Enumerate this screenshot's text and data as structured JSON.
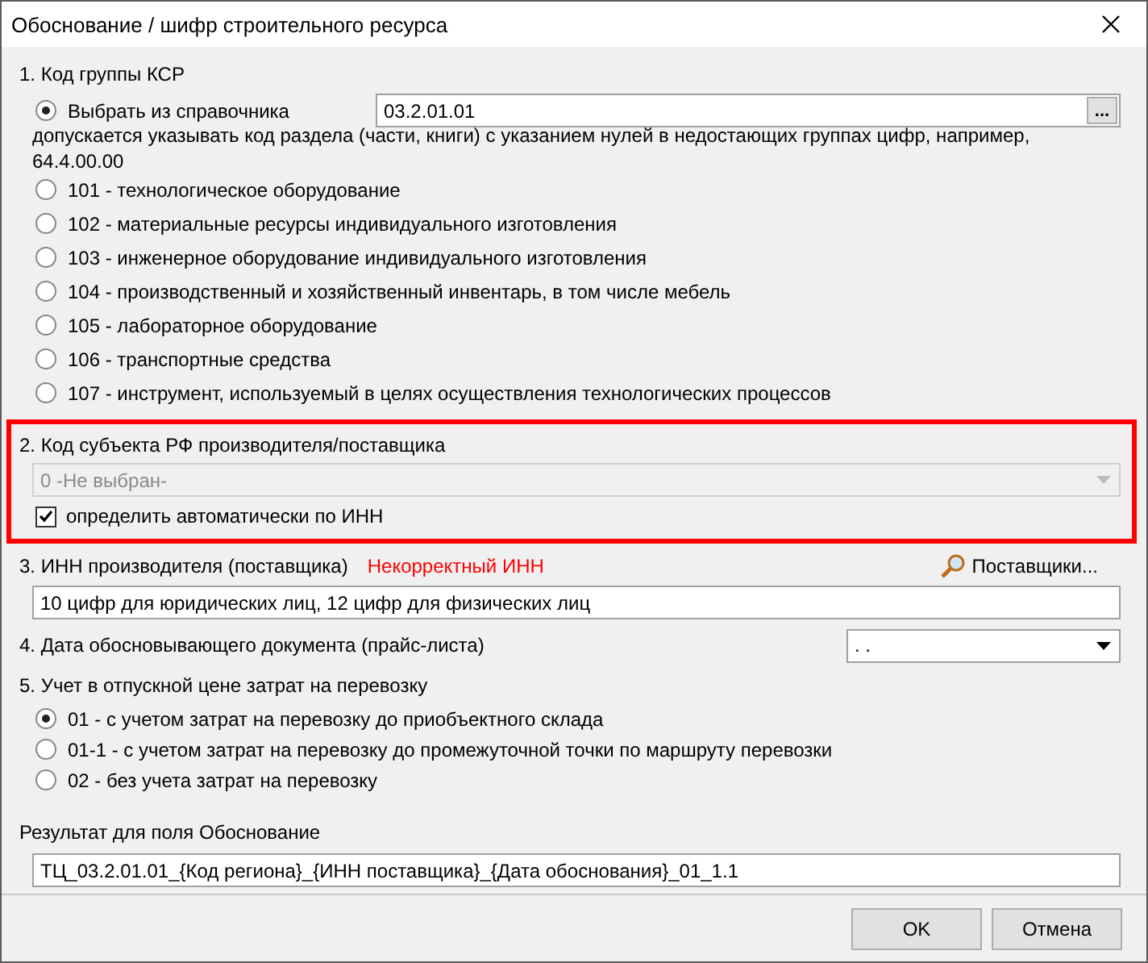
{
  "window": {
    "title": "Обоснование / шифр строительного ресурса"
  },
  "section1": {
    "heading": "1. Код группы КСР",
    "choose": {
      "label": "Выбрать из справочника",
      "selected": true,
      "value": "03.2.01.01",
      "button": "..."
    },
    "hint": "допускается указывать код раздела (части, книги) с указанием нулей в недостающих группах цифр,  например, 64.4.00.00",
    "options": [
      {
        "label": "101 - технологическое оборудование",
        "selected": false
      },
      {
        "label": "102 - материальные ресурсы индивидуального изготовления",
        "selected": false
      },
      {
        "label": "103 - инженерное оборудование индивидуального изготовления",
        "selected": false
      },
      {
        "label": "104 - производственный и хозяйственный инвентарь, в том числе мебель",
        "selected": false
      },
      {
        "label": "105 - лабораторное оборудование",
        "selected": false
      },
      {
        "label": "106 - транспортные средства",
        "selected": false
      },
      {
        "label": "107 - инструмент, используемый в целях осуществления технологических процессов",
        "selected": false
      }
    ]
  },
  "section2": {
    "heading": "2. Код субъекта РФ производителя/поставщика",
    "highlighted": true,
    "combo": {
      "value": "0 -Не выбран-",
      "disabled": true
    },
    "auto": {
      "label": "определить автоматически по ИНН",
      "checked": true
    }
  },
  "section3": {
    "heading": "3. ИНН производителя (поставщика)",
    "error": "Некорректный ИНН",
    "suppliers_button": "Поставщики...",
    "value": "10 цифр для юридических лиц, 12 цифр для физических лиц"
  },
  "section4": {
    "heading": "4. Дата обосновывающего документа (прайс-листа)",
    "value": ". ."
  },
  "section5": {
    "heading": "5. Учет в отпускной цене затрат на перевозку",
    "options": [
      {
        "label": "01 - с учетом затрат на перевозку до приобъектного склада",
        "selected": true
      },
      {
        "label": "01-1 - с учетом затрат на перевозку до промежуточной точки по маршруту перевозки",
        "selected": false
      },
      {
        "label": "02 - без учета затрат на перевозку",
        "selected": false
      }
    ]
  },
  "result": {
    "label": "Результат для поля Обоснование",
    "value": "ТЦ_03.2.01.01_{Код региона}_{ИНН поставщика}_{Дата обоснования}_01_1.1"
  },
  "buttons": [
    "OK",
    "Отмена"
  ]
}
